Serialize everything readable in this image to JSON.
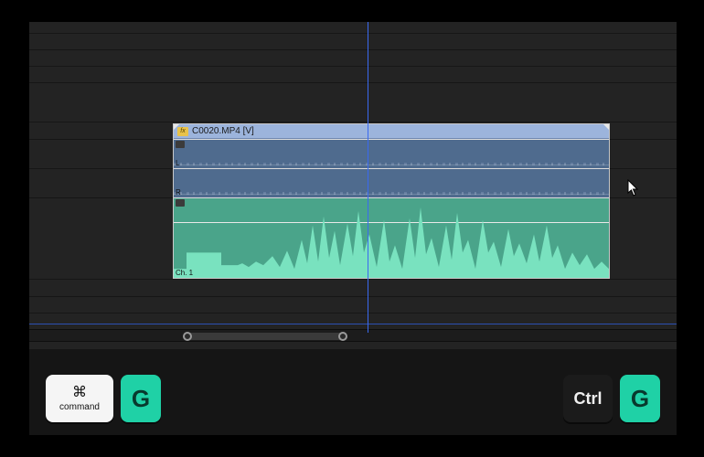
{
  "clip": {
    "title": "C0020.MP4 [V]",
    "fx_badge": "fx",
    "audio_lanes": [
      {
        "label": "L"
      },
      {
        "label": "R"
      }
    ],
    "linked_lane": {
      "label": "Ch. 1"
    }
  },
  "shortcuts": {
    "mac": {
      "modifier_glyph": "⌘",
      "modifier_word": "command",
      "letter": "G"
    },
    "win": {
      "modifier_word": "Ctrl",
      "letter": "G"
    }
  },
  "colors": {
    "accent_key": "#1fd1a6",
    "clip_header": "#9cb4dc",
    "audio_linked": "#4aa48a",
    "waveform": "#79e2bf",
    "playhead": "#3a6af0"
  }
}
